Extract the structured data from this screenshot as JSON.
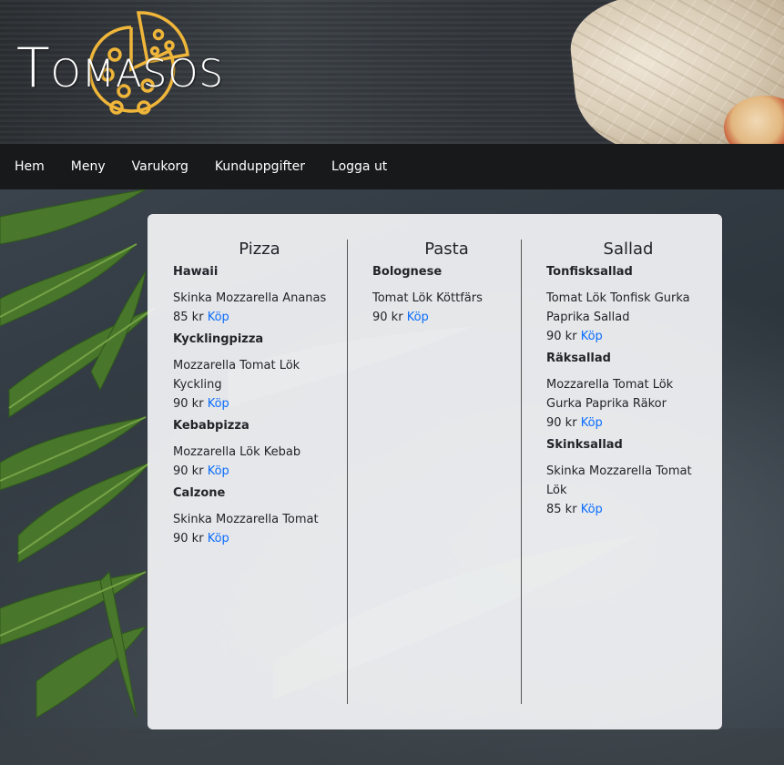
{
  "brand": {
    "name": "Tomasos",
    "icon": "pizza-icon",
    "accent": "#f0b63a"
  },
  "nav": [
    {
      "label": "Hem"
    },
    {
      "label": "Meny"
    },
    {
      "label": "Varukorg"
    },
    {
      "label": "Kunduppgifter"
    },
    {
      "label": "Logga ut"
    }
  ],
  "menu": {
    "pizza": {
      "title": "Pizza",
      "items": [
        {
          "name": "Hawaii",
          "ingredients": "Skinka Mozzarella Ananas",
          "price": "85 kr",
          "buy": "Köp"
        },
        {
          "name": "Kycklingpizza",
          "ingredients": "Mozzarella Tomat Lök Kyckling",
          "price": "90 kr",
          "buy": "Köp"
        },
        {
          "name": "Kebabpizza",
          "ingredients": "Mozzarella Lök Kebab",
          "price": "90 kr",
          "buy": "Köp"
        },
        {
          "name": "Calzone",
          "ingredients": "Skinka Mozzarella Tomat",
          "price": "90 kr",
          "buy": "Köp"
        }
      ]
    },
    "pasta": {
      "title": "Pasta",
      "items": [
        {
          "name": "Bolognese",
          "ingredients": "Tomat Lök Köttfärs",
          "price": "90 kr",
          "buy": "Köp"
        }
      ]
    },
    "sallad": {
      "title": "Sallad",
      "items": [
        {
          "name": "Tonfisksallad",
          "ingredients": "Tomat Lök Tonfisk Gurka Paprika Sallad",
          "price": "90 kr",
          "buy": "Köp"
        },
        {
          "name": "Räksallad",
          "ingredients": "Mozzarella Tomat Lök Gurka Paprika Räkor",
          "price": "90 kr",
          "buy": "Köp"
        },
        {
          "name": "Skinksallad",
          "ingredients": "Skinka Mozzarella Tomat Lök",
          "price": "85 kr",
          "buy": "Köp"
        }
      ]
    }
  },
  "colors": {
    "link": "#0d6efd",
    "nav_bg": "#17191b"
  }
}
